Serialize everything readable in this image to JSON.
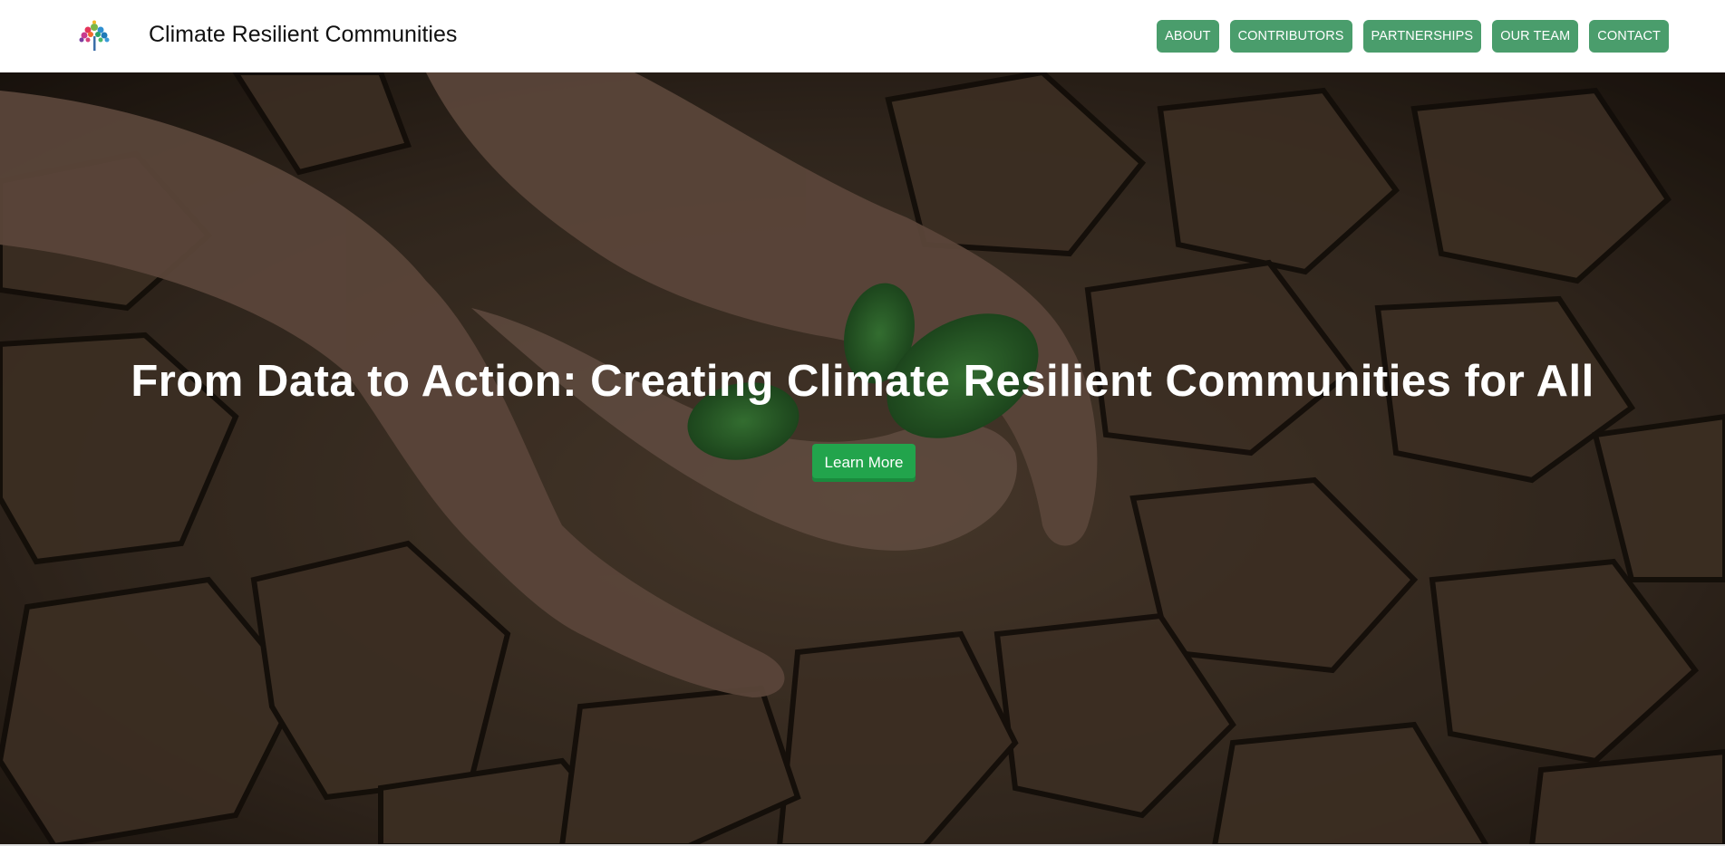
{
  "brand": {
    "name": "Climate Resilient Communities",
    "logo_icon": "tree-logo-icon"
  },
  "nav": {
    "items": [
      {
        "label": "ABOUT"
      },
      {
        "label": "CONTRIBUTORS"
      },
      {
        "label": "PARTNERSHIPS"
      },
      {
        "label": "OUR TEAM"
      },
      {
        "label": "CONTACT"
      }
    ]
  },
  "hero": {
    "title": "From Data to Action: Creating Climate Resilient Communities for All",
    "cta_label": "Learn More",
    "background_image": "hands-holding-seedling-over-cracked-earth"
  },
  "colors": {
    "nav_button": "#4a9d6c",
    "cta_button": "#22a44c",
    "hero_text": "#ffffff"
  }
}
